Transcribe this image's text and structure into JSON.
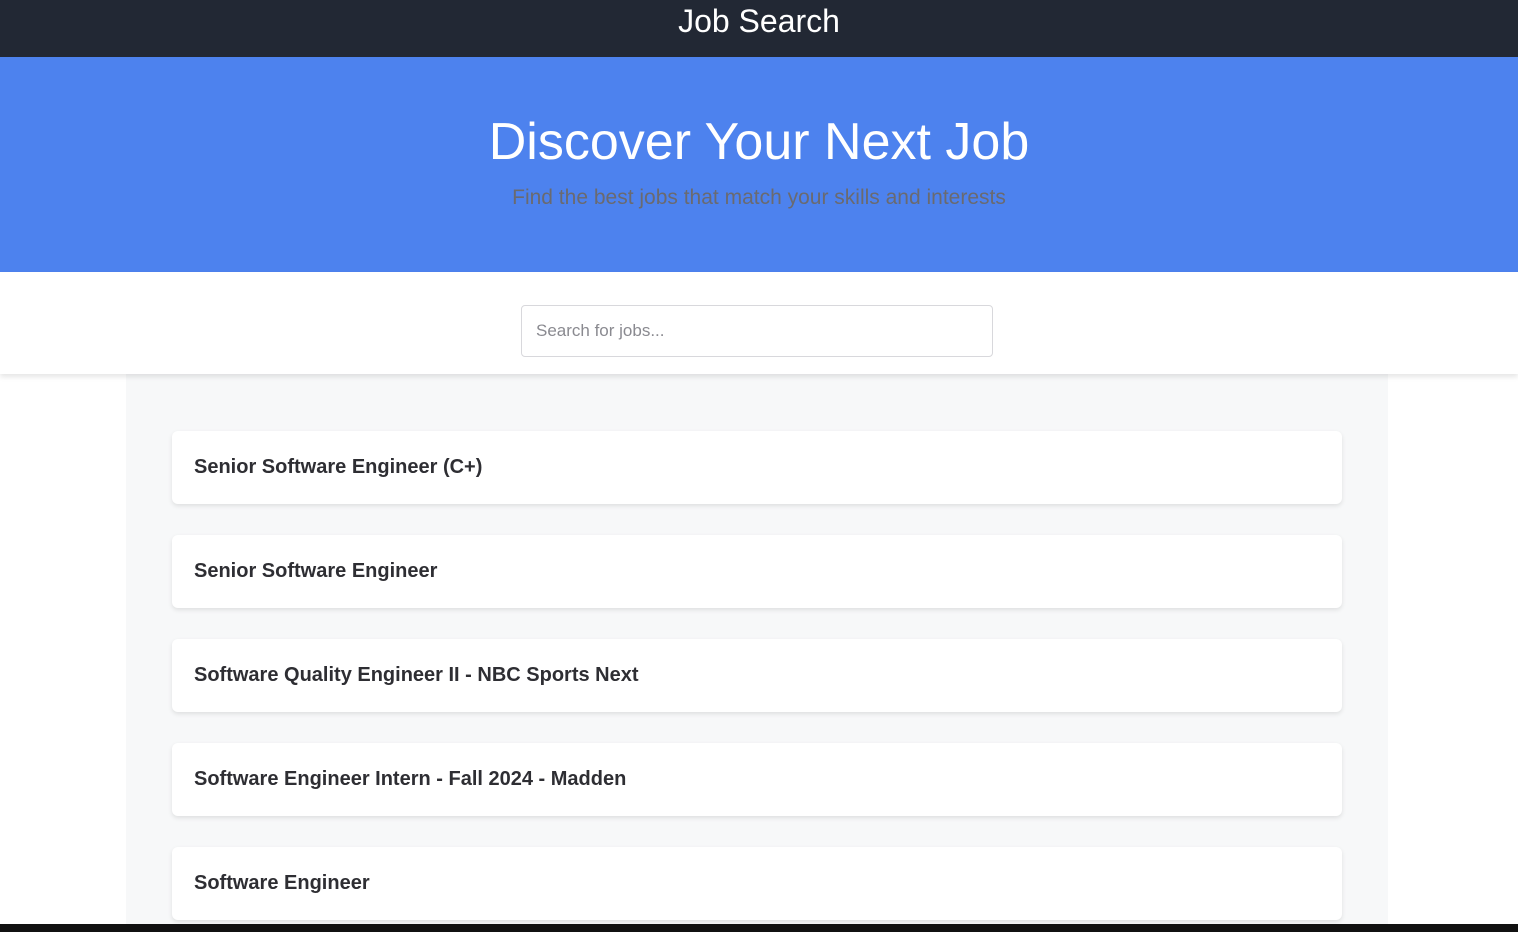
{
  "header": {
    "title": "Job Search"
  },
  "hero": {
    "title": "Discover Your Next Job",
    "subtitle": "Find the best jobs that match your skills and interests"
  },
  "search": {
    "placeholder": "Search for jobs...",
    "value": ""
  },
  "jobs": [
    {
      "title": "Senior Software Engineer (C+)"
    },
    {
      "title": "Senior Software Engineer"
    },
    {
      "title": "Software Quality Engineer II - NBC Sports Next"
    },
    {
      "title": "Software Engineer Intern - Fall 2024 - Madden"
    },
    {
      "title": "Software Engineer"
    }
  ],
  "colors": {
    "header_bg": "#222834",
    "hero_bg": "#4d82ee",
    "results_bg": "#f7f8f9"
  }
}
